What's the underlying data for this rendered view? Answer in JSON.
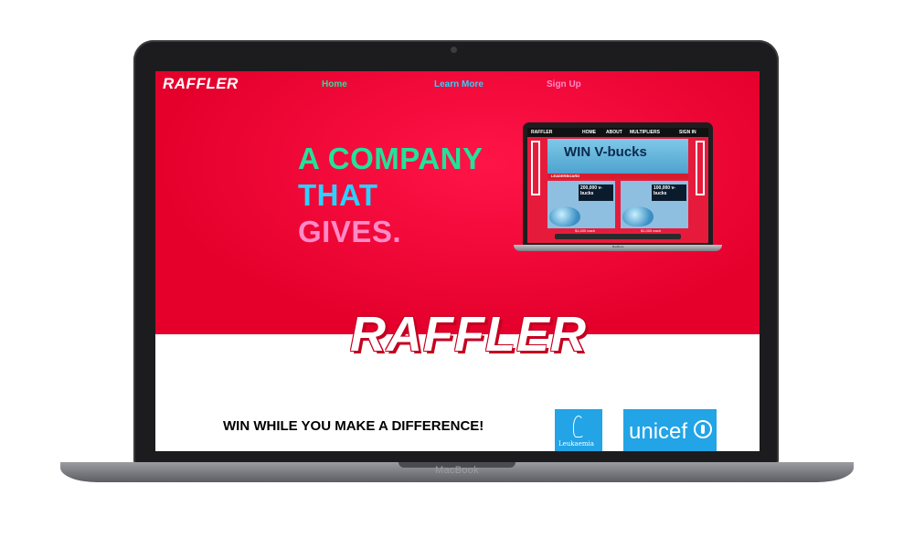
{
  "device": {
    "label": "MacBook"
  },
  "website": {
    "brand": "RAFFLER",
    "nav": [
      {
        "label": "Home",
        "color": "#22e29b"
      },
      {
        "label": "Learn More",
        "color": "#2ad2ff"
      },
      {
        "label": "Sign Up",
        "color": "#ff8ac8"
      }
    ],
    "tagline": [
      {
        "text": "A COMPANY",
        "color": "#22e29b"
      },
      {
        "text": "THAT",
        "color": "#2ad2ff"
      },
      {
        "text": "GIVES.",
        "color": "#ff8ac8"
      }
    ],
    "big_logo": "RAFFLER",
    "mission_text": "WIN WHILE YOU MAKE A DIFFERENCE!",
    "partners": {
      "leukaemia": {
        "label": "Leukaemia"
      },
      "unicef": {
        "label": "unicef"
      }
    },
    "mini_screenshot": {
      "brand": "RAFFLER",
      "nav": [
        "HOME",
        "ABOUT",
        "MULTIPLIERS",
        "SIGN IN"
      ],
      "headline": "WIN V-bucks",
      "section": "LEADERBOARD",
      "cards": [
        "200,000 v-bucks",
        "100,000 v-bucks"
      ],
      "prices": [
        "$1,000 each",
        "$1,000 each"
      ],
      "base_label": "MacBook"
    },
    "colors": {
      "hero": "#e5002c",
      "accent_green": "#22e29b",
      "accent_cyan": "#2ad2ff",
      "accent_pink": "#ff8ac8",
      "partner_blue": "#22a4e6"
    }
  }
}
